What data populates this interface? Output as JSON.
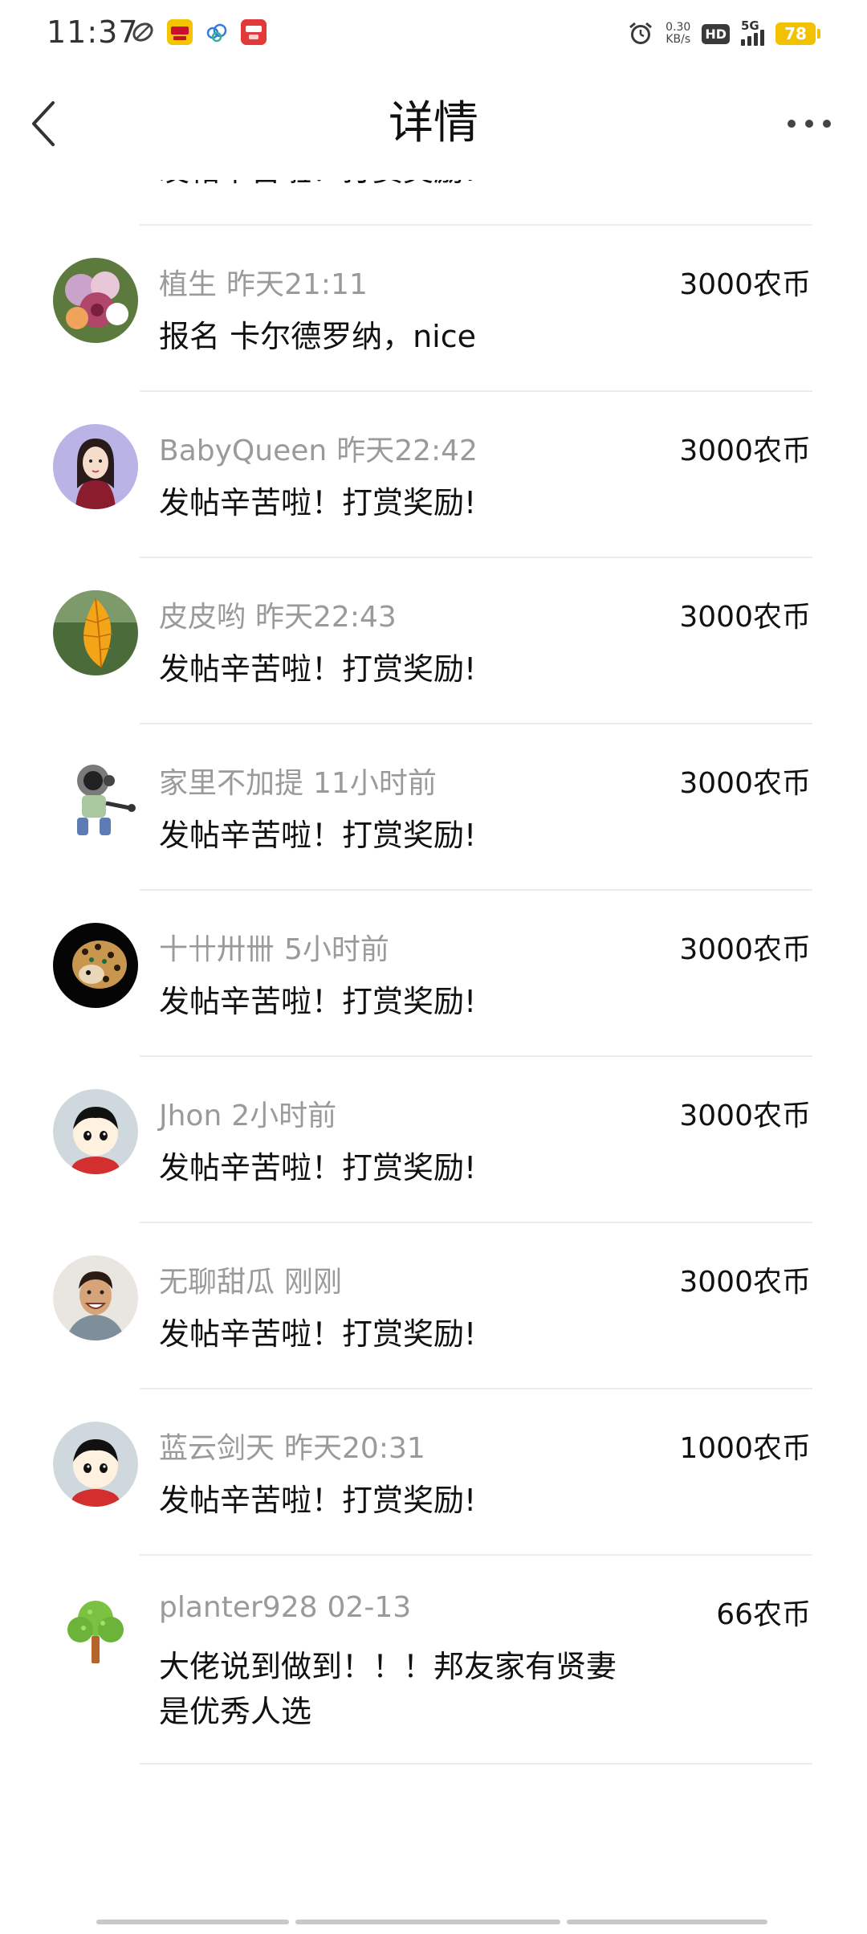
{
  "status_bar": {
    "time": "11:37",
    "net_speed_value": "0.30",
    "net_speed_unit": "KB/s",
    "hd_label": "HD",
    "network_label": "5G",
    "battery_level": "78",
    "app_icons": [
      "leaf-app-icon",
      "yellow-app-icon",
      "cloud-app-icon",
      "red-app-icon"
    ]
  },
  "header": {
    "title": "详情",
    "back_icon": "chevron-left-icon",
    "more_icon": "more-dots-icon"
  },
  "colors": {
    "meta_text": "#9a9a9a",
    "primary_text": "#111111",
    "divider": "#ececec",
    "battery": "#f2c200"
  },
  "rewards": [
    {
      "user": "",
      "time": "",
      "amount": "",
      "message": "发帖辛苦啦！打赏奖励!",
      "avatar": "cartoon-boy-avatar"
    },
    {
      "user": "植生",
      "time": "昨天21:11",
      "amount": "3000农币",
      "message": "报名 卡尔德罗纳，nice",
      "avatar": "flower-photo-avatar"
    },
    {
      "user": "BabyQueen",
      "time": "昨天22:42",
      "amount": "3000农币",
      "message": "发帖辛苦啦！打赏奖励!",
      "avatar": "girl-photo-avatar"
    },
    {
      "user": "皮皮哟",
      "time": "昨天22:43",
      "amount": "3000农币",
      "message": "发帖辛苦啦！打赏奖励!",
      "avatar": "leaf-photo-avatar"
    },
    {
      "user": "家里不加提",
      "time": "11小时前",
      "amount": "3000农币",
      "message": "发帖辛苦啦！打赏奖励!",
      "avatar": "robot-figure-avatar"
    },
    {
      "user": "十卄卅卌",
      "time": "5小时前",
      "amount": "3000农币",
      "message": "发帖辛苦啦！打赏奖励!",
      "avatar": "leopard-photo-avatar"
    },
    {
      "user": "Jhon",
      "time": "2小时前",
      "amount": "3000农币",
      "message": "发帖辛苦啦！打赏奖励!",
      "avatar": "cartoon-boy-avatar"
    },
    {
      "user": "无聊甜瓜",
      "time": "刚刚",
      "amount": "3000农币",
      "message": "发帖辛苦啦！打赏奖励!",
      "avatar": "man-photo-avatar"
    },
    {
      "user": "蓝云剑天",
      "time": "昨天20:31",
      "amount": "1000农币",
      "message": "发帖辛苦啦！打赏奖励!",
      "avatar": "cartoon-boy-avatar"
    },
    {
      "user": "planter928",
      "time": "02-13",
      "amount": "66农币",
      "message": "大佬说到做到！！！邦友家有贤妻是优秀人选",
      "avatar": "tree-avatar"
    }
  ]
}
